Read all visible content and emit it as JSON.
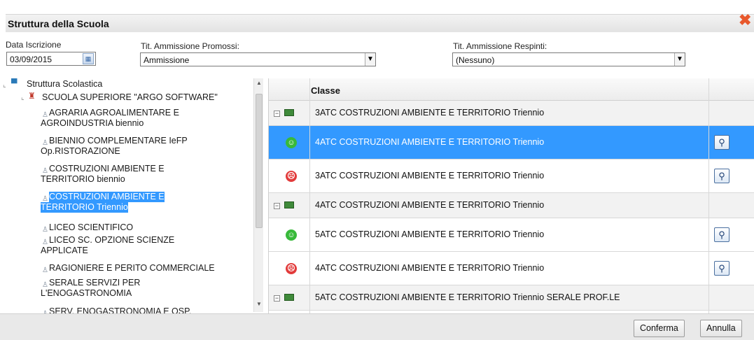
{
  "dialog": {
    "title": "Struttura della Scuola",
    "close_glyph": "✖"
  },
  "fields": {
    "data_iscrizione_label": "Data Iscrizione",
    "data_iscrizione_value": "03/09/2015",
    "promossi_label": "Tit. Ammissione Promossi:",
    "promossi_value": "Ammissione",
    "respinti_label": "Tit. Ammissione Respinti:",
    "respinti_value": "(Nessuno)"
  },
  "tree": {
    "root": "Struttura Scolastica",
    "school": "SCUOLA SUPERIORE \"ARGO SOFTWARE\"",
    "items": [
      {
        "line1": "AGRARIA AGROALIMENTARE E",
        "line2": "AGROINDUSTRIA biennio"
      },
      {
        "line1": "BIENNIO COMPLEMENTARE IeFP",
        "line2": "Op.RISTORAZIONE"
      },
      {
        "line1": "COSTRUZIONI AMBIENTE E",
        "line2": "TERRITORIO biennio"
      },
      {
        "line1": "COSTRUZIONI AMBIENTE E",
        "line2": "TERRITORIO Triennio",
        "selected": true
      },
      {
        "line1": "LICEO SCIENTIFICO",
        "line2": ""
      },
      {
        "line1": "LICEO SC. OPZIONE SCIENZE",
        "line2": "APPLICATE"
      },
      {
        "line1": "RAGIONIERE E PERITO COMMERCIALE",
        "line2": ""
      },
      {
        "line1": "SERALE SERVIZI PER",
        "line2": "L'ENOGASTRONOMIA"
      },
      {
        "line1": "SERV. ENOGASTRONOMIA E OSP.",
        "line2": ""
      }
    ]
  },
  "grid": {
    "header_classe": "Classe",
    "rows": [
      {
        "kind": "group",
        "text": "3ATC COSTRUZIONI AMBIENTE E TERRITORIO Triennio"
      },
      {
        "kind": "happy",
        "text": "4ATC COSTRUZIONI AMBIENTE E TERRITORIO Triennio",
        "selected": true
      },
      {
        "kind": "sad",
        "text": "3ATC COSTRUZIONI AMBIENTE E TERRITORIO Triennio"
      },
      {
        "kind": "group",
        "text": "4ATC COSTRUZIONI AMBIENTE E TERRITORIO Triennio"
      },
      {
        "kind": "happy",
        "text": "5ATC COSTRUZIONI AMBIENTE E TERRITORIO Triennio"
      },
      {
        "kind": "sad",
        "text": "4ATC COSTRUZIONI AMBIENTE E TERRITORIO Triennio"
      },
      {
        "kind": "group",
        "text": "5ATC COSTRUZIONI AMBIENTE E TERRITORIO Triennio SERALE PROF.LE"
      }
    ]
  },
  "buttons": {
    "conferma": "Conferma",
    "annulla": "Annulla"
  },
  "colors": {
    "selection": "#3399ff",
    "close": "#e8582c",
    "happy": "#38b93a",
    "sad": "#e23b3b"
  },
  "icons": {
    "close": "close-icon",
    "calendar": "calendar-icon",
    "dropdown": "chevron-down-icon",
    "zoom": "magnifier-icon",
    "happy": "smiley-happy-icon",
    "sad": "smiley-sad-icon"
  }
}
